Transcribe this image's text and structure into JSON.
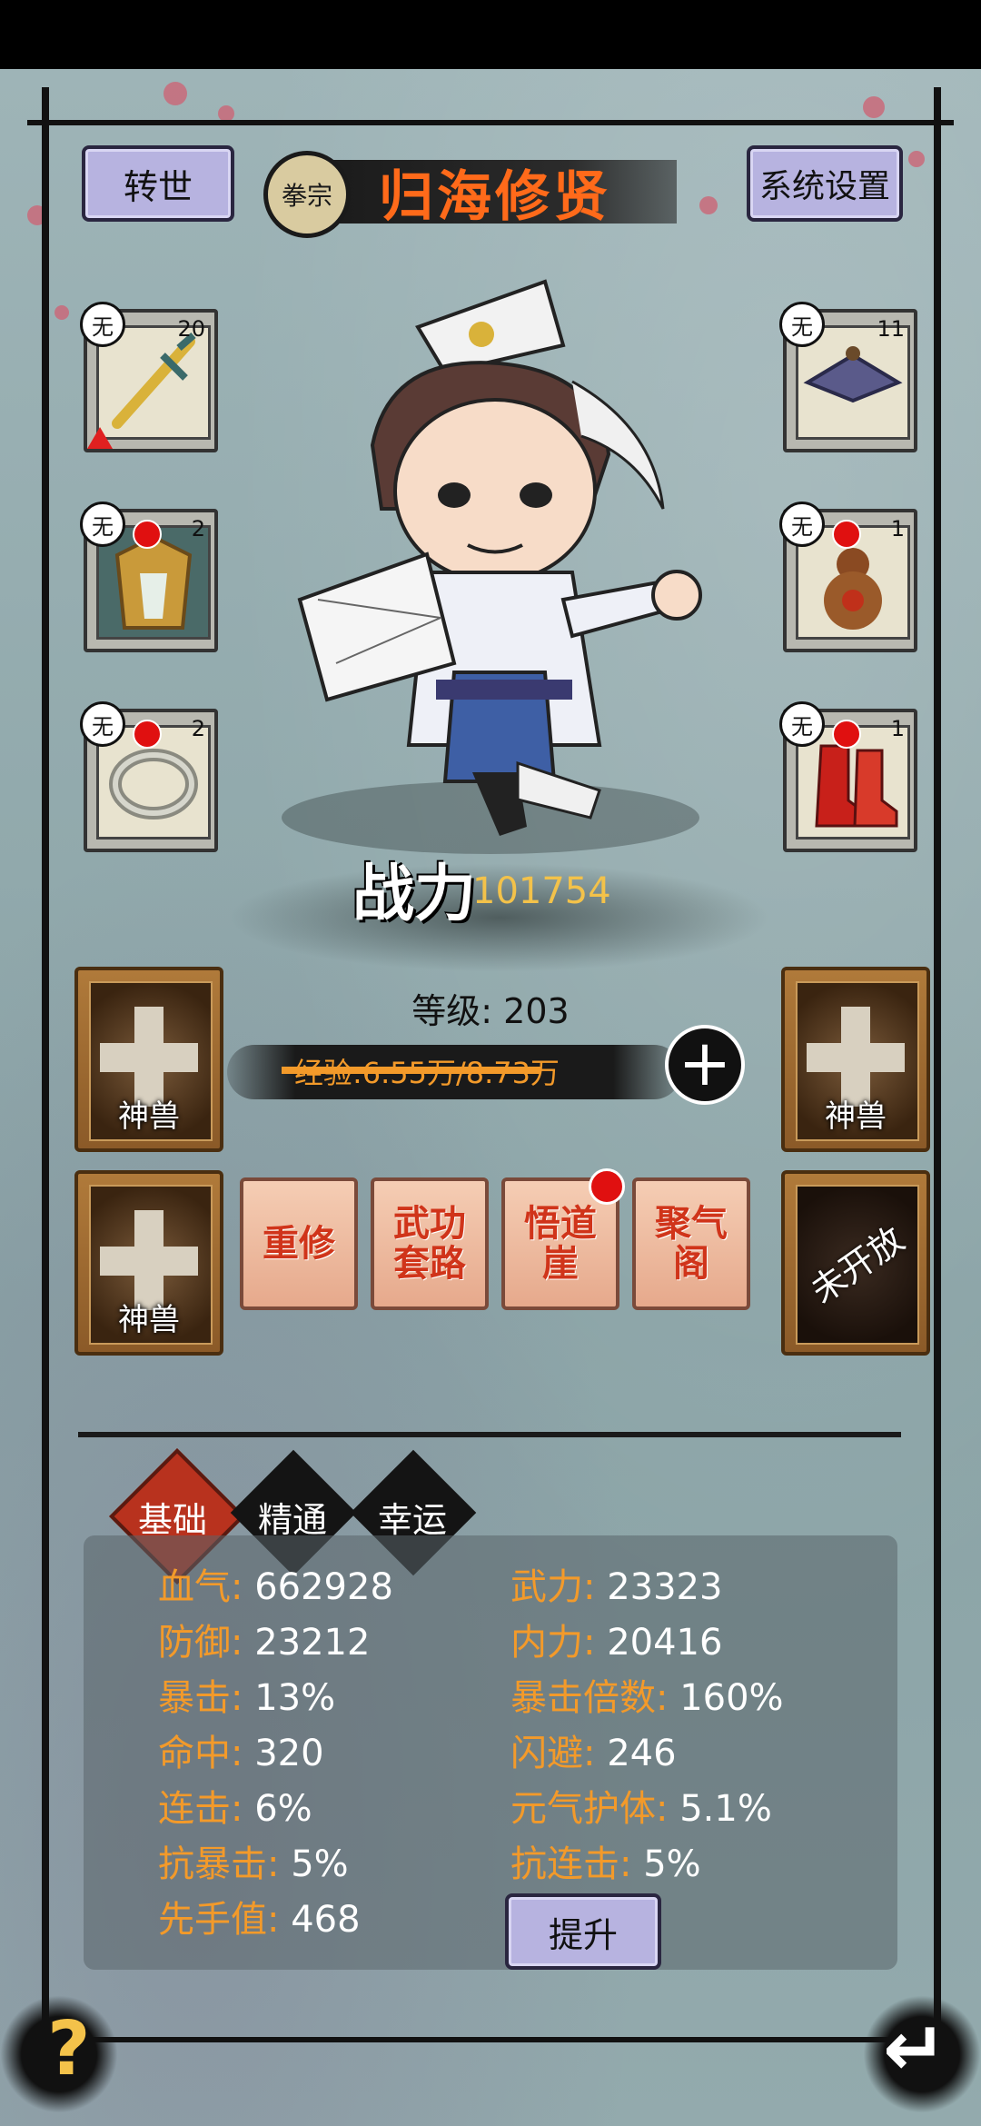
{
  "header": {
    "rebirth_label": "转世",
    "sect_label": "拳宗",
    "player_name": "归海修贤",
    "settings_label": "系统设置"
  },
  "equipment": {
    "left": [
      {
        "tag": "无",
        "count": "20",
        "icon": "golden-sword-icon",
        "warning": true,
        "red_dot": false
      },
      {
        "tag": "无",
        "count": "2",
        "icon": "armor-icon",
        "warning": false,
        "red_dot": true
      },
      {
        "tag": "无",
        "count": "2",
        "icon": "ring-icon",
        "warning": false,
        "red_dot": true
      }
    ],
    "right": [
      {
        "tag": "无",
        "count": "11",
        "icon": "hat-icon",
        "red_dot": false
      },
      {
        "tag": "无",
        "count": "1",
        "icon": "gourd-icon",
        "red_dot": true
      },
      {
        "tag": "无",
        "count": "1",
        "icon": "boots-icon",
        "red_dot": true
      }
    ]
  },
  "character": {
    "power_label": "战力",
    "power_value": "101754",
    "level_text": "等级: 203",
    "exp_text": "经验:6.55万/8.73万",
    "exp_fraction": 0.75
  },
  "beasts": {
    "label": "神兽",
    "locked_label": "未开放"
  },
  "skills": [
    {
      "label": "重修",
      "red_dot": false
    },
    {
      "label": "武功套路",
      "red_dot": false
    },
    {
      "label": "悟道崖",
      "red_dot": true
    },
    {
      "label": "聚气阁",
      "red_dot": false
    }
  ],
  "tabs": [
    {
      "label": "基础",
      "active": true
    },
    {
      "label": "精通",
      "active": false
    },
    {
      "label": "幸运",
      "active": false
    }
  ],
  "stats": {
    "left": [
      {
        "k": "血气:",
        "v": "662928"
      },
      {
        "k": "防御:",
        "v": "23212"
      },
      {
        "k": "暴击:",
        "v": "13%"
      },
      {
        "k": "命中:",
        "v": "320"
      },
      {
        "k": "连击:",
        "v": "6%"
      },
      {
        "k": "抗暴击:",
        "v": "5%"
      },
      {
        "k": "先手值:",
        "v": "468"
      }
    ],
    "right": [
      {
        "k": "武力:",
        "v": "23323"
      },
      {
        "k": "内力:",
        "v": "20416"
      },
      {
        "k": "暴击倍数:",
        "v": "160%"
      },
      {
        "k": "闪避:",
        "v": "246"
      },
      {
        "k": "元气护体:",
        "v": "5.1%"
      },
      {
        "k": "抗连击:",
        "v": "5%"
      }
    ],
    "upgrade_label": "提升"
  },
  "footer": {
    "help_label": "?",
    "back_label": "↵"
  },
  "colors": {
    "accent_orange": "#f39a2a",
    "title_orange": "#ff6a1a",
    "button_purple": "#b7b3e0",
    "active_tab_red": "#b8321e"
  }
}
